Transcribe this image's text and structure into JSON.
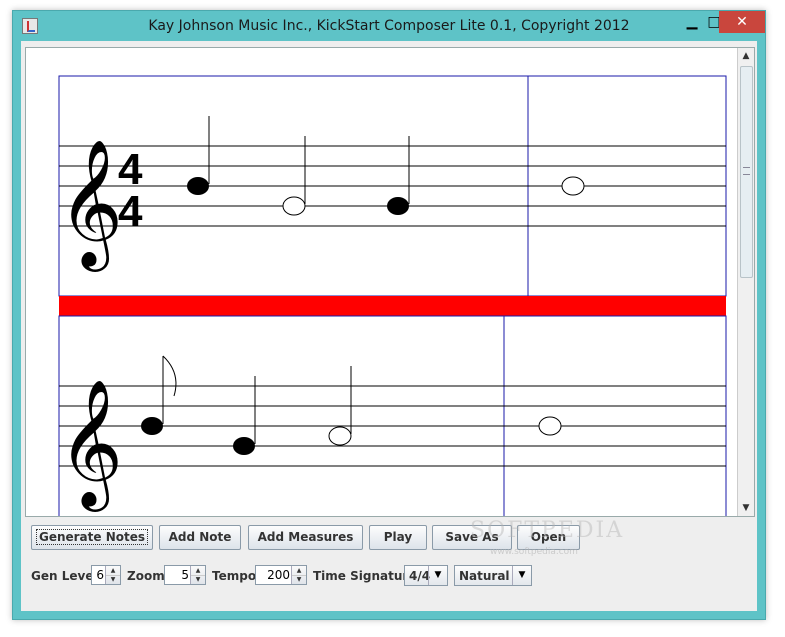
{
  "window": {
    "title": "Kay Johnson Music Inc., KickStart Composer Lite 0.1, Copyright 2012",
    "minimize_glyph": "▁",
    "maximize_glyph": "□",
    "close_glyph": "✕"
  },
  "score": {
    "time_signature_top": "4",
    "time_signature_bottom": "4",
    "clef_glyph": "𝄞",
    "divider_color": "#ff0000",
    "system_border_color": "#1a1aa8",
    "staves": [
      {
        "notes": [
          "quarter-filled",
          "half-open",
          "quarter-filled",
          "whole-open"
        ]
      },
      {
        "notes": [
          "eighth-filled",
          "quarter-filled",
          "half-open",
          "whole-open"
        ]
      }
    ]
  },
  "buttons": {
    "generate_notes": "Generate Notes",
    "add_note": "Add Note",
    "add_measures": "Add Measures",
    "play": "Play",
    "save_as": "Save As",
    "open": "Open"
  },
  "controls": {
    "gen_level_label": "Gen Level",
    "gen_level_value": "6",
    "zoom_label": "Zoom",
    "zoom_value": "5",
    "tempo_label": "Tempo",
    "tempo_value": "200",
    "time_signature_label": "Time Signature",
    "time_signature_value": "4/4",
    "key_value": "Natural"
  },
  "watermark": {
    "text": "SOFTPEDIA",
    "url": "www.softpedia.com"
  }
}
